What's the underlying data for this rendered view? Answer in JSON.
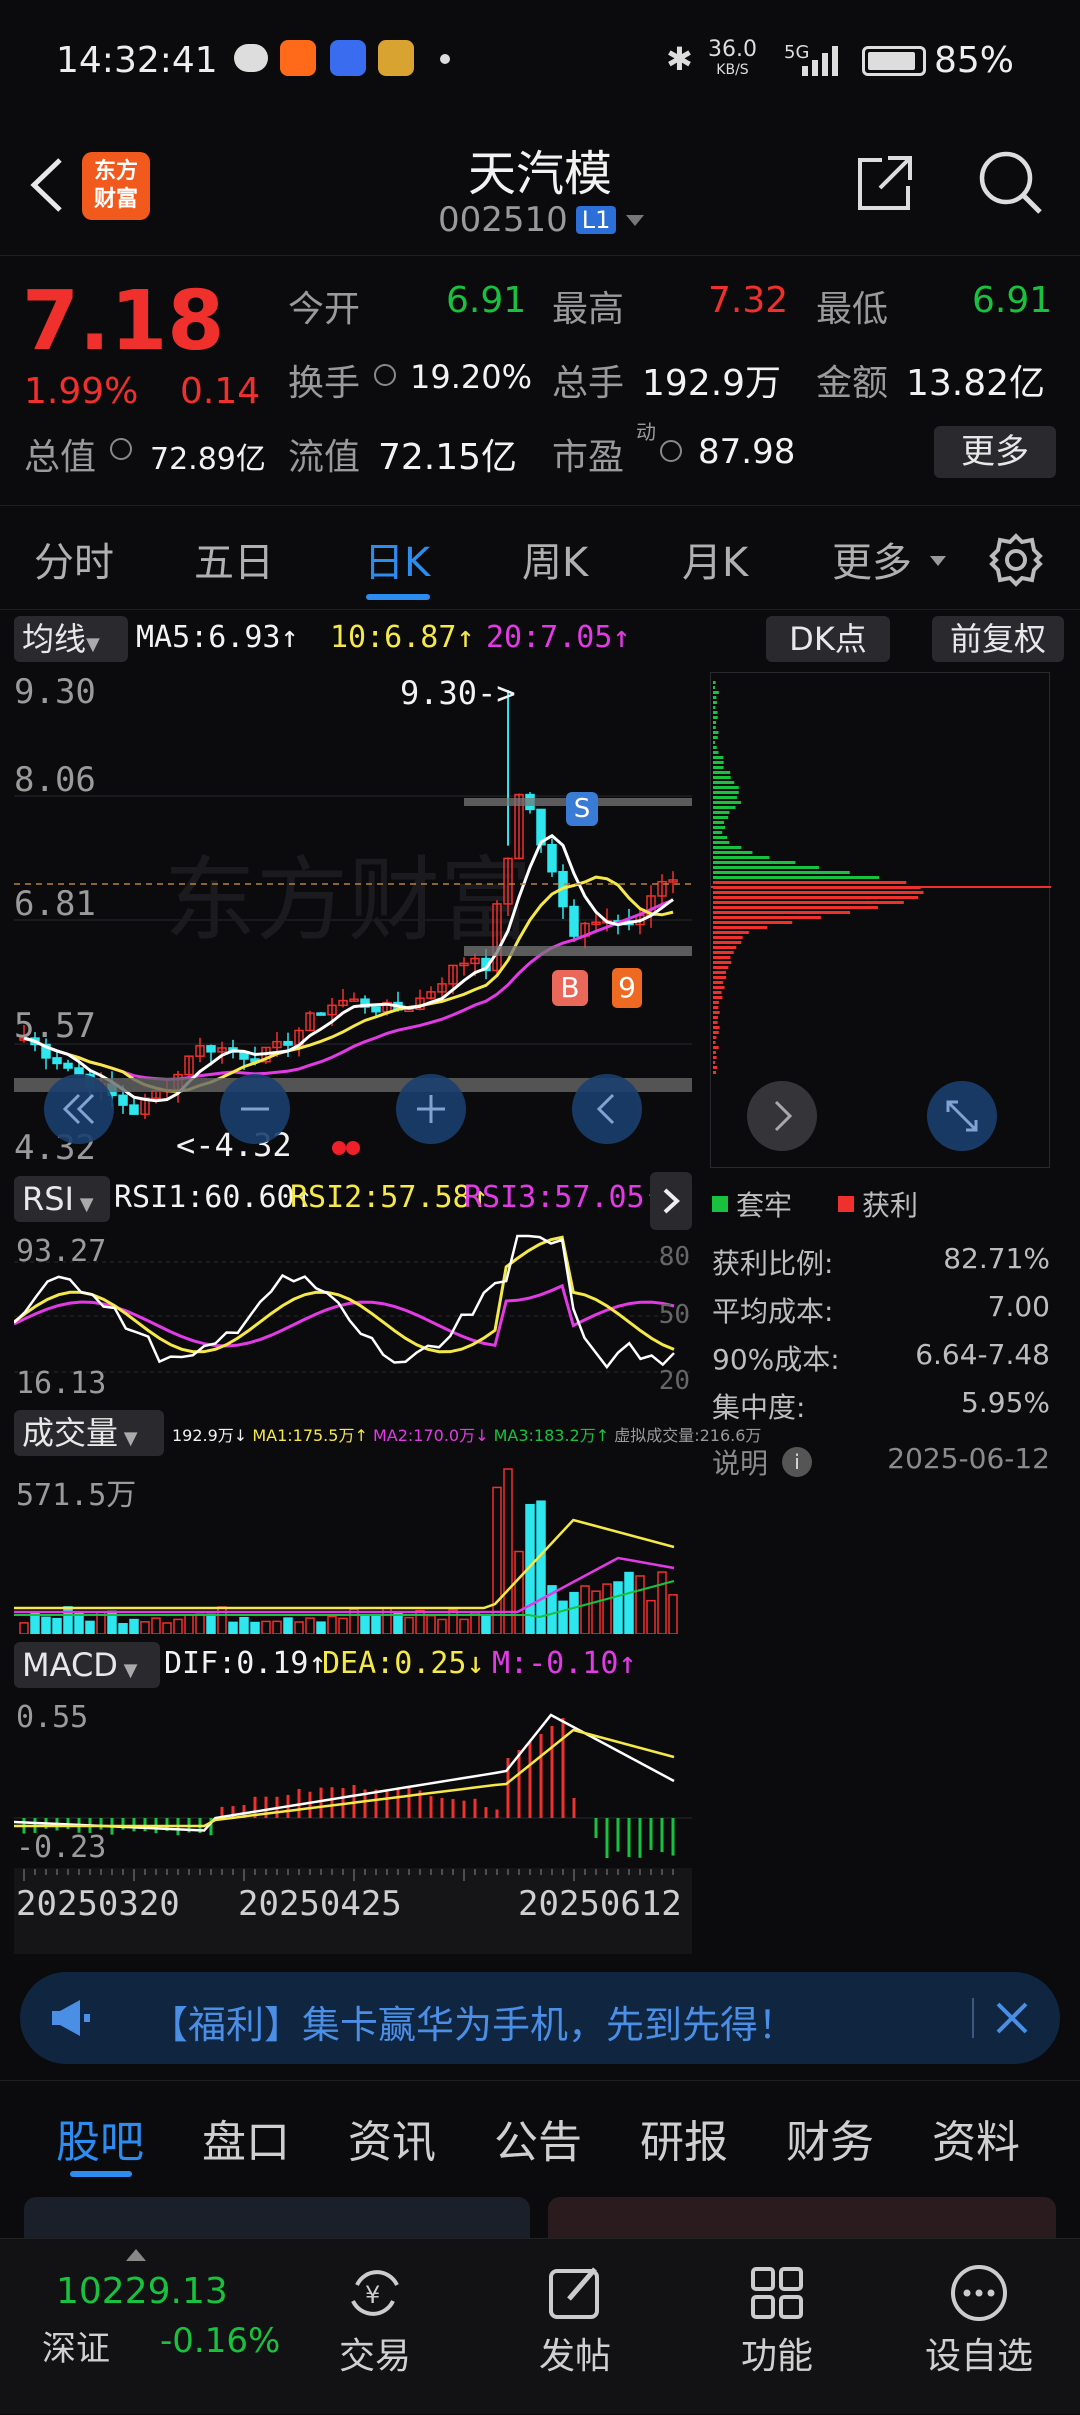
{
  "status_bar": {
    "time": "14:32:41",
    "net_speed": "36.0",
    "net_unit": "KB/S",
    "network": "5G",
    "battery": "85%"
  },
  "header": {
    "title": "天汽模",
    "code": "002510",
    "level": "L1",
    "logo_line1": "东方",
    "logo_line2": "财富"
  },
  "quote": {
    "price": "7.18",
    "change_pct": "1.99%",
    "change": "0.14",
    "open_label": "今开",
    "open": "6.91",
    "high_label": "最高",
    "high": "7.32",
    "low_label": "最低",
    "low": "6.91",
    "turnover_label": "换手",
    "turnover": "19.20%",
    "volume_label": "总手",
    "volume": "192.9万",
    "amount_label": "金额",
    "amount": "13.82亿",
    "mcap_label": "总值",
    "mcap": "72.89亿",
    "float_label": "流值",
    "float_cap": "72.15亿",
    "pe_label": "市盈",
    "pe_sup": "动",
    "pe": "87.98",
    "more": "更多"
  },
  "tabs": [
    "分时",
    "五日",
    "日K",
    "周K",
    "月K",
    "更多"
  ],
  "active_tab": "日K",
  "kline": {
    "ma_label": "均线",
    "ma5": "MA5:6.93↑",
    "ma10": "10:6.87↑",
    "ma20": "20:7.05↑",
    "dk_button": "DK点",
    "fq_button": "前复权",
    "ticks": [
      "9.30",
      "8.06",
      "6.81",
      "5.57",
      "4.32"
    ],
    "high_note": "9.30->",
    "low_note": "<-4.32",
    "signals": [
      "S",
      "B",
      "9"
    ]
  },
  "rsi": {
    "label": "RSI",
    "rsi1": "RSI1:60.60↑",
    "rsi2": "RSI2:57.58↑",
    "rsi3": "RSI3:57.05↑",
    "top": "93.27",
    "bottom": "16.13",
    "r80": "80",
    "r50": "50",
    "r20": "20"
  },
  "volume": {
    "label": "成交量",
    "summary": "192.9万↓",
    "ma1": "MA1:175.5万↑",
    "ma2": "MA2:170.0万↓",
    "ma3": "MA3:183.2万↑",
    "virtual": "虚拟成交量:216.6万",
    "max": "571.5万"
  },
  "macd": {
    "label": "MACD",
    "dif": "DIF:0.19↑",
    "dea": "DEA:0.25↓",
    "m": "M:-0.10↑",
    "top": "0.55",
    "bottom": "-0.23"
  },
  "dates": [
    "20250320",
    "20250425",
    "20250612"
  ],
  "chips": {
    "legend_trapped": "套牢",
    "legend_profit": "获利",
    "rows": [
      {
        "label": "获利比例:",
        "value": "82.71%"
      },
      {
        "label": "平均成本:",
        "value": "7.00"
      },
      {
        "label": "90%成本:",
        "value": "6.64-7.48"
      },
      {
        "label": "集中度:",
        "value": "5.95%"
      }
    ],
    "note": "说明",
    "date": "2025-06-12"
  },
  "promo": {
    "text": "【福利】集卡赢华为手机，先到先得！"
  },
  "bottom_tabs": [
    "股吧",
    "盘口",
    "资讯",
    "公告",
    "研报",
    "财务",
    "资料"
  ],
  "index": {
    "value": "10229.13",
    "name": "深证",
    "change": "-0.16%"
  },
  "nav": [
    {
      "label": "交易"
    },
    {
      "label": "发帖"
    },
    {
      "label": "功能"
    },
    {
      "label": "设自选"
    }
  ],
  "colors": {
    "up": "#f0302c",
    "down": "#19c23e",
    "accent": "#2d8cf0",
    "ma5": "#ffffff",
    "ma10": "#f5e84a",
    "ma20": "#e23be6"
  }
}
